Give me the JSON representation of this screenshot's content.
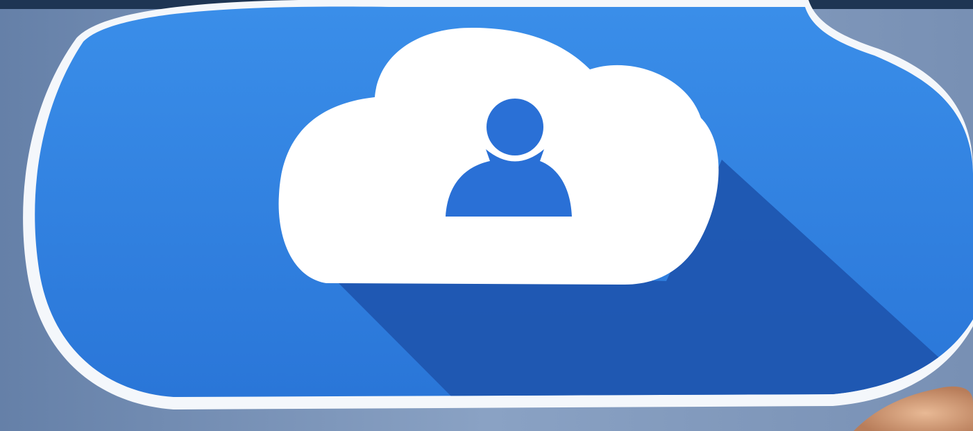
{
  "image": {
    "subject": "cloud-user-icon",
    "colors": {
      "background": "#7a92b6",
      "top_band": "#1e3553",
      "cloud_outer_outline": "#f4f7fb",
      "cloud_outer_fill": "#2e7fe0",
      "cloud_outer_fill_light": "#3b8de8",
      "long_shadow": "#1f56b0",
      "cloud_inner_fill": "#ffffff",
      "user_glyph": "#2a70d6",
      "hand": "#d9a27e"
    },
    "icons": [
      "cloud-icon",
      "user-icon"
    ]
  }
}
